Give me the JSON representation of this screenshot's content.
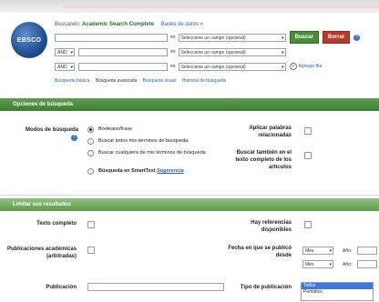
{
  "logo": {
    "text": "EBSCO"
  },
  "header": {
    "searching_label": "Buscando:",
    "database": "Academic Search Complete",
    "choose_db": "Bases de datos »"
  },
  "search_rows": [
    {
      "bool": "",
      "en": "en",
      "field": "Seleccione un campo (opcional)"
    },
    {
      "bool": "AND",
      "en": "en",
      "field": "Seleccione un campo (opcional)"
    },
    {
      "bool": "AND",
      "en": "en",
      "field": "Seleccione un campo (opcional)"
    }
  ],
  "buttons": {
    "search": "Buscar",
    "clear": "Borrar",
    "help": "?"
  },
  "add_row": "Agregar fila",
  "search_links": [
    "Búsqueda básica",
    "Búsqueda avanzada",
    "Búsqueda visual",
    "Historial de búsqueda"
  ],
  "section1": {
    "title": "Opciones de búsqueda",
    "modes_label": "Modos de búsqueda",
    "modes": [
      "Booleano/frase",
      "Buscar todos mis términos de búsqueda",
      "Buscar cualquiera de mis términos de búsqueda"
    ],
    "smart_prefix": "Búsqueda en SmartText",
    "smart_link": "Sugerencia",
    "apply_related": "Aplicar palabras relacionadas",
    "fulltext_search": "Buscar también en el texto completo de los artículos"
  },
  "section2": {
    "title": "Limitar sus resultados",
    "full_text": "Texto completo",
    "refs_available": "Hay referencias disponibles",
    "scholarly": "Publicaciones académicas (arbitradas)",
    "published_from": "Fecha en que se publicó desde",
    "month": "Mes",
    "year": "Año:",
    "publication": "Publicación",
    "pub_type": "Tipo de publicación",
    "pub_type_options": [
      "Todos",
      "Periódico"
    ]
  }
}
